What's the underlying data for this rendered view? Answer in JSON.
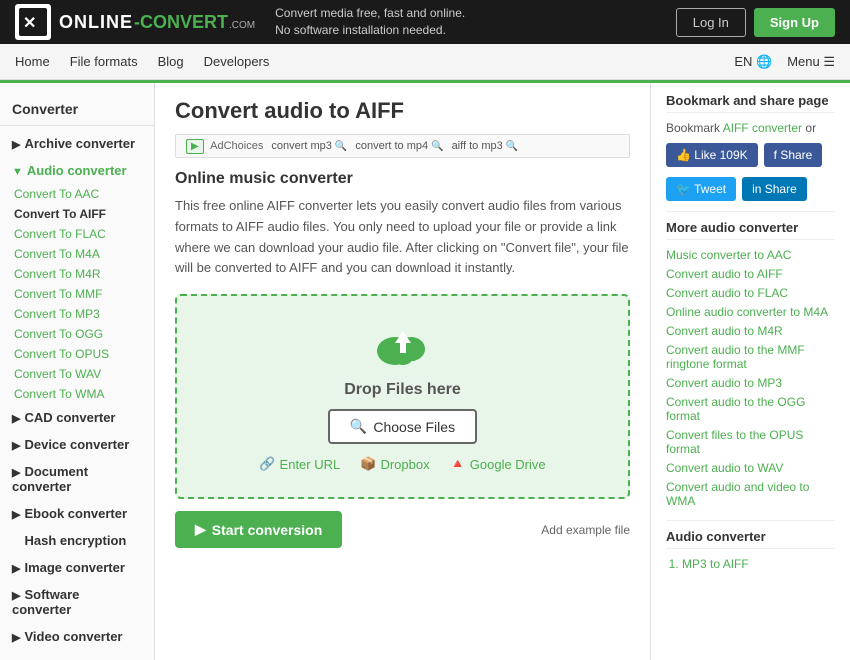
{
  "header": {
    "logo_text": "ONLINE-CONVERT",
    "logo_com": ".COM",
    "tagline_line1": "Convert media free, fast and online.",
    "tagline_line2": "No software installation needed.",
    "login_label": "Log In",
    "signup_label": "Sign Up"
  },
  "nav": {
    "items": [
      "Home",
      "File formats",
      "Blog",
      "Developers"
    ],
    "lang": "EN",
    "menu": "Menu"
  },
  "sidebar": {
    "title": "Converter",
    "sections": [
      {
        "id": "archive",
        "label": "Archive converter",
        "expanded": false
      },
      {
        "id": "audio",
        "label": "Audio converter",
        "expanded": true
      },
      {
        "id": "cad",
        "label": "CAD converter",
        "expanded": false
      },
      {
        "id": "device",
        "label": "Device converter",
        "expanded": false
      },
      {
        "id": "document",
        "label": "Document converter",
        "expanded": false
      },
      {
        "id": "ebook",
        "label": "Ebook converter",
        "expanded": false
      },
      {
        "id": "hash",
        "label": "Hash encryption",
        "expanded": false
      },
      {
        "id": "image",
        "label": "Image converter",
        "expanded": false
      },
      {
        "id": "software",
        "label": "Software converter",
        "expanded": false
      },
      {
        "id": "video",
        "label": "Video converter",
        "expanded": false
      }
    ],
    "audio_sub": [
      "Convert To AAC",
      "Convert To AIFF",
      "Convert To FLAC",
      "Convert To M4A",
      "Convert To M4R",
      "Convert To MMF",
      "Convert To MP3",
      "Convert To OGG",
      "Convert To OPUS",
      "Convert To WAV",
      "Convert To WMA"
    ]
  },
  "main": {
    "page_title": "Convert audio to AIFF",
    "ad_label": "AdChoices",
    "ad_items": [
      "convert mp3",
      "convert to mp4",
      "aiff to mp3"
    ],
    "section_title": "Online music converter",
    "section_text": "This free online AIFF converter lets you easily convert audio files from various formats to AIFF audio files. You only need to upload your file or provide a link where we can download your audio file. After clicking on \"Convert file\", your file will be converted to AIFF and you can download it instantly.",
    "upload": {
      "drop_text": "Drop Files here",
      "choose_files": "Choose Files",
      "enter_url": "Enter URL",
      "dropbox": "Dropbox",
      "google_drive": "Google Drive"
    },
    "start_label": "Start conversion",
    "add_example": "Add example file"
  },
  "right_panel": {
    "bookmark_title": "Bookmark and share page",
    "bookmark_text": "Bookmark",
    "converter_link": "AIFF converter",
    "bookmark_or": "or",
    "social": [
      {
        "id": "fb-like",
        "label": "Like 109K",
        "type": "fb-like"
      },
      {
        "id": "fb-share",
        "label": "Share",
        "type": "fb-share"
      },
      {
        "id": "tw-tweet",
        "label": "Tweet",
        "type": "tw-tweet"
      },
      {
        "id": "li-share",
        "label": "Share",
        "type": "li-share"
      }
    ],
    "more_title": "More audio converter",
    "more_links": [
      "Music converter to AAC",
      "Convert audio to AIFF",
      "Convert audio to FLAC",
      "Online audio converter to M4A",
      "Convert audio to M4R",
      "Convert audio to the MMF ringtone format",
      "Convert audio to MP3",
      "Convert audio to the OGG format",
      "Convert files to the OPUS format",
      "Convert audio to WAV",
      "Convert audio and video to WMA"
    ],
    "audio_title": "Audio converter",
    "audio_list": [
      "MP3 to AIFF"
    ]
  }
}
